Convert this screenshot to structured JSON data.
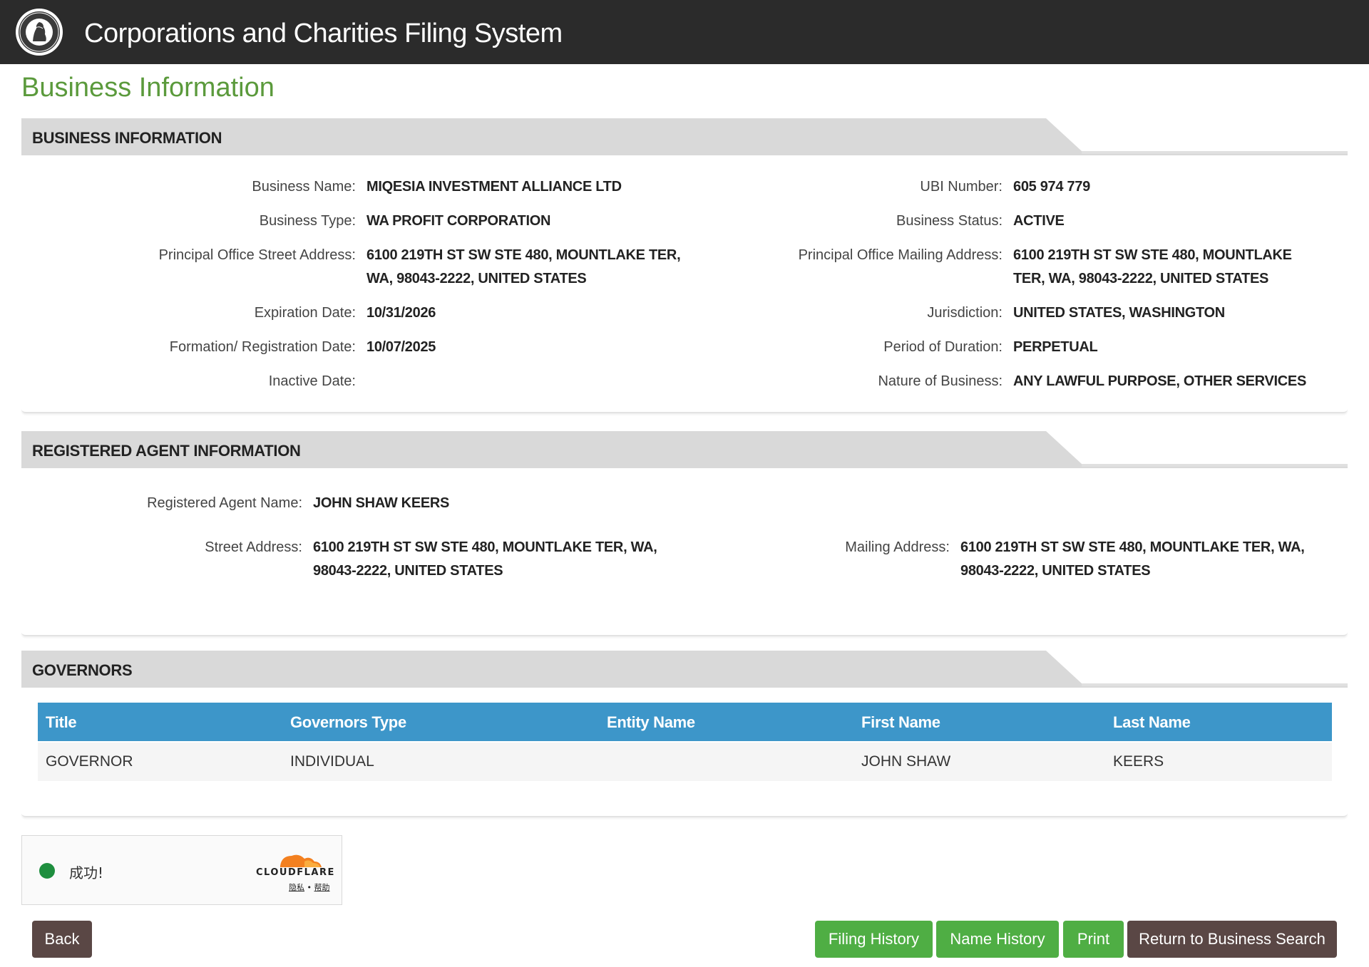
{
  "header": {
    "app_title": "Corporations and Charities Filing System"
  },
  "page_title": "Business Information",
  "business_info": {
    "heading": "BUSINESS INFORMATION",
    "left": [
      {
        "label": "Business Name:",
        "value": "MIQESIA INVESTMENT ALLIANCE LTD"
      },
      {
        "label": "Business Type:",
        "value": "WA PROFIT CORPORATION"
      },
      {
        "label": "Principal Office Street Address:",
        "value": "6100 219TH ST SW STE 480, MOUNTLAKE TER, WA, 98043-2222, UNITED STATES"
      },
      {
        "label": "Expiration Date:",
        "value": "10/31/2026"
      },
      {
        "label": "Formation/ Registration Date:",
        "value": "10/07/2025"
      },
      {
        "label": "Inactive Date:",
        "value": ""
      }
    ],
    "right": [
      {
        "label": "UBI Number:",
        "value": "605 974 779"
      },
      {
        "label": "Business Status:",
        "value": "ACTIVE"
      },
      {
        "label": "Principal Office Mailing Address:",
        "value": "6100 219TH ST SW STE 480, MOUNTLAKE TER, WA, 98043-2222, UNITED STATES"
      },
      {
        "label": "Jurisdiction:",
        "value": "UNITED STATES, WASHINGTON"
      },
      {
        "label": "Period of Duration:",
        "value": "PERPETUAL"
      },
      {
        "label": "Nature of Business:",
        "value": "ANY LAWFUL PURPOSE, OTHER SERVICES"
      }
    ]
  },
  "agent_info": {
    "heading": "REGISTERED AGENT INFORMATION",
    "name_label": "Registered Agent Name:",
    "name_value": "JOHN SHAW KEERS",
    "street_label": "Street Address:",
    "street_value": "6100 219TH ST SW STE 480, MOUNTLAKE TER, WA, 98043-2222, UNITED STATES",
    "mailing_label": "Mailing Address:",
    "mailing_value": "6100 219TH ST SW STE 480, MOUNTLAKE TER, WA, 98043-2222, UNITED STATES"
  },
  "governors": {
    "heading": "GOVERNORS",
    "columns": [
      "Title",
      "Governors Type",
      "Entity Name",
      "First Name",
      "Last Name"
    ],
    "rows": [
      [
        "GOVERNOR",
        "INDIVIDUAL",
        "",
        "JOHN SHAW",
        "KEERS"
      ]
    ]
  },
  "cloudflare": {
    "status": "成功!",
    "brand": "CLOUDFLARE",
    "privacy": "隐私",
    "separator": "•",
    "help": "帮助",
    "dot_color": "#1e8e3e"
  },
  "buttons": {
    "back": "Back",
    "filing_history": "Filing History",
    "name_history": "Name History",
    "print": "Print",
    "return": "Return to Business Search"
  },
  "colors": {
    "header_bg": "#2b2b2b",
    "title_green": "#5b9a3c",
    "table_header": "#3d96c9",
    "button_green": "#4fae44",
    "button_dark": "#5a4745"
  }
}
